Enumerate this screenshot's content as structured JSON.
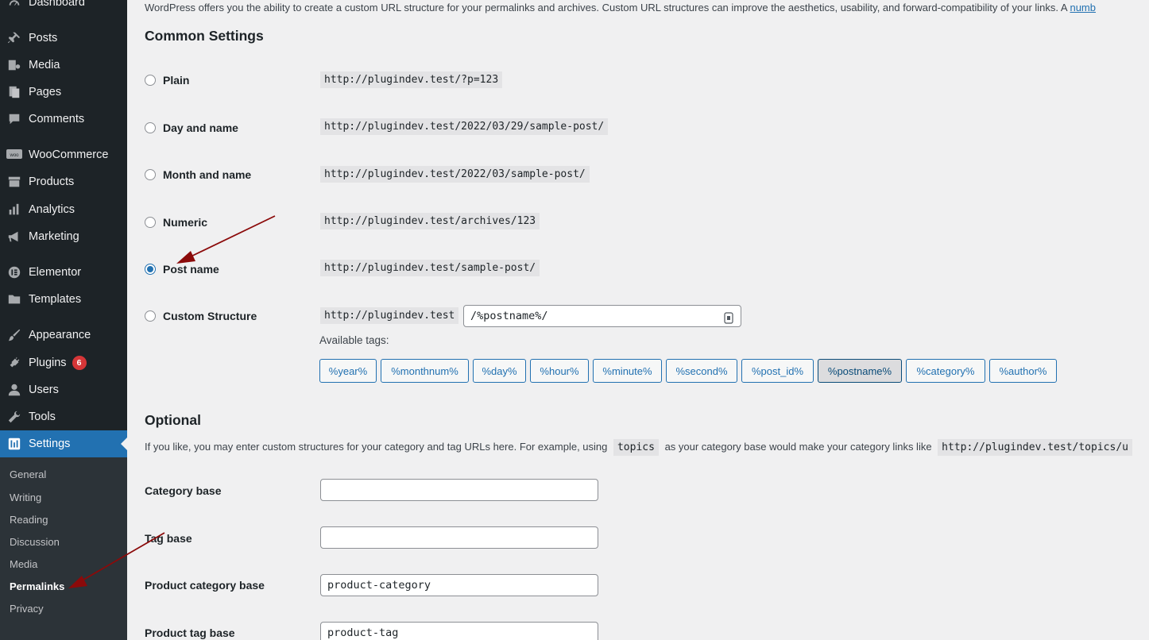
{
  "sidebar": {
    "menu": [
      {
        "label": "Dashboard",
        "icon": "dashboard-icon"
      },
      {
        "label": "Posts",
        "icon": "pin-icon"
      },
      {
        "label": "Media",
        "icon": "media-icon"
      },
      {
        "label": "Pages",
        "icon": "pages-icon"
      },
      {
        "label": "Comments",
        "icon": "comment-icon"
      },
      {
        "label": "WooCommerce",
        "icon": "woocommerce-icon"
      },
      {
        "label": "Products",
        "icon": "archive-icon"
      },
      {
        "label": "Analytics",
        "icon": "bar-chart-icon"
      },
      {
        "label": "Marketing",
        "icon": "megaphone-icon"
      },
      {
        "label": "Elementor",
        "icon": "elementor-icon"
      },
      {
        "label": "Templates",
        "icon": "folder-icon"
      },
      {
        "label": "Appearance",
        "icon": "paintbrush-icon"
      },
      {
        "label": "Plugins",
        "icon": "plug-icon",
        "badge": "6"
      },
      {
        "label": "Users",
        "icon": "user-icon"
      },
      {
        "label": "Tools",
        "icon": "wrench-icon"
      },
      {
        "label": "Settings",
        "icon": "settings-icon"
      }
    ],
    "submenu": [
      "General",
      "Writing",
      "Reading",
      "Discussion",
      "Media",
      "Permalinks",
      "Privacy"
    ],
    "current_submenu": "Permalinks"
  },
  "main": {
    "intro_text": "WordPress offers you the ability to create a custom URL structure for your permalinks and archives. Custom URL structures can improve the aesthetics, usability, and forward-compatibility of your links. A ",
    "intro_link": "numb",
    "common_heading": "Common Settings",
    "options": [
      {
        "label": "Plain",
        "example": "http://plugindev.test/?p=123"
      },
      {
        "label": "Day and name",
        "example": "http://plugindev.test/2022/03/29/sample-post/"
      },
      {
        "label": "Month and name",
        "example": "http://plugindev.test/2022/03/sample-post/"
      },
      {
        "label": "Numeric",
        "example": "http://plugindev.test/archives/123"
      },
      {
        "label": "Post name",
        "example": "http://plugindev.test/sample-post/"
      },
      {
        "label": "Custom Structure",
        "example": "http://plugindev.test"
      }
    ],
    "selected_option": "Post name",
    "custom_structure_value": "/%postname%/",
    "available_tags_label": "Available tags:",
    "tags": [
      "%year%",
      "%monthnum%",
      "%day%",
      "%hour%",
      "%minute%",
      "%second%",
      "%post_id%",
      "%postname%",
      "%category%",
      "%author%"
    ],
    "pressed_tag": "%postname%",
    "optional_heading": "Optional",
    "optional_desc_1": "If you like, you may enter custom structures for your category and tag URLs here. For example, using ",
    "optional_code": "topics",
    "optional_desc_2": " as your category base would make your category links like ",
    "optional_code_2": "http://plugindev.test/topics/u",
    "fields": [
      {
        "label": "Category base",
        "value": ""
      },
      {
        "label": "Tag base",
        "value": ""
      },
      {
        "label": "Product category base",
        "value": "product-category"
      },
      {
        "label": "Product tag base",
        "value": "product-tag"
      }
    ]
  },
  "colors": {
    "accent": "#2271b1",
    "sidebar": "#1d2327",
    "annotation_arrow": "#8b0a0a"
  }
}
